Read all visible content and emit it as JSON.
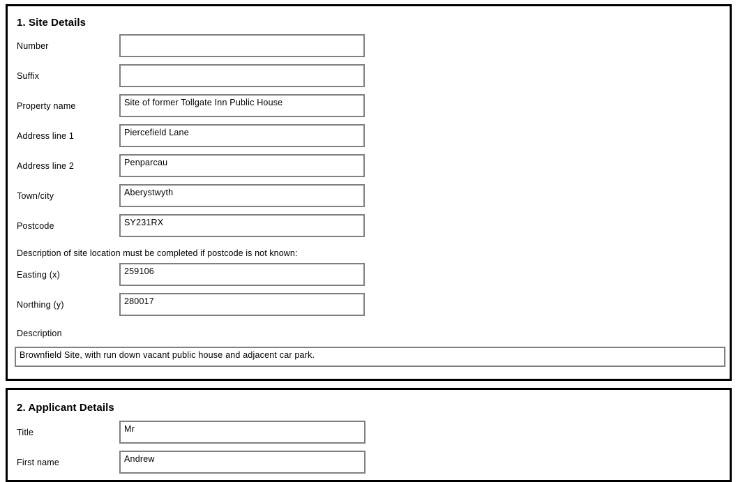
{
  "sections": [
    {
      "heading": "1. Site Details",
      "fields": [
        {
          "label": "Number",
          "value": ""
        },
        {
          "label": "Suffix",
          "value": ""
        },
        {
          "label": "Property name",
          "value": "Site of former Tollgate Inn Public House"
        },
        {
          "label": "Address line 1",
          "value": "Piercefield Lane"
        },
        {
          "label": "Address line 2",
          "value": "Penparcau"
        },
        {
          "label": "Town/city",
          "value": "Aberystwyth"
        },
        {
          "label": "Postcode",
          "value": "SY231RX"
        }
      ],
      "note": "Description of site location must be completed if postcode is not known:",
      "coordinate_fields": [
        {
          "label": "Easting (x)",
          "value": "259106"
        },
        {
          "label": "Northing (y)",
          "value": "280017"
        }
      ],
      "description_label": "Description",
      "description_value": "Brownfield Site, with run down vacant public house and adjacent car park."
    },
    {
      "heading": "2. Applicant Details",
      "fields": [
        {
          "label": "Title",
          "value": "Mr"
        },
        {
          "label": "First name",
          "value": "Andrew"
        }
      ]
    }
  ],
  "colors": {
    "panel_border": "#000000",
    "field_border": "#808080",
    "text": "#000000",
    "background": "#ffffff"
  }
}
